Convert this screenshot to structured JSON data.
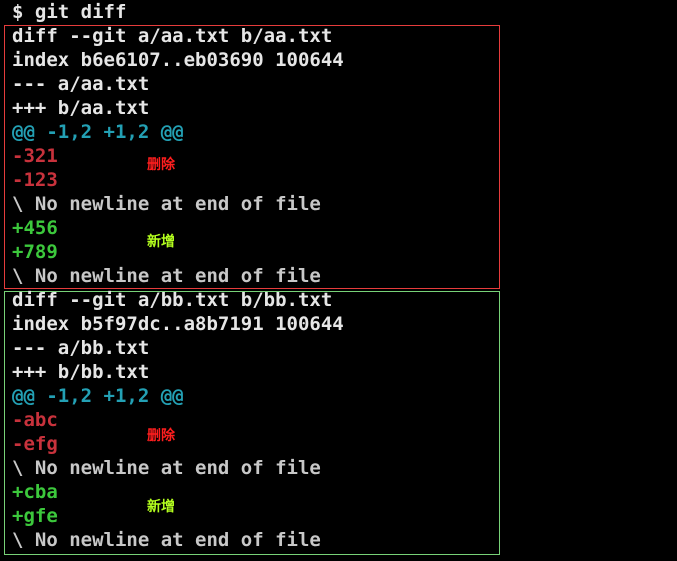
{
  "prompt": "$ git diff",
  "diffs": [
    {
      "header": "diff --git a/aa.txt b/aa.txt",
      "index": "index b6e6107..eb03690 100644",
      "from_file": "--- a/aa.txt",
      "to_file": "+++ b/aa.txt",
      "hunk": "@@ -1,2 +1,2 @@",
      "removed": [
        "-321",
        "-123"
      ],
      "no_newline_1": "\\ No newline at end of file",
      "added": [
        "+456",
        "+789"
      ],
      "no_newline_2": "\\ No newline at end of file",
      "removed_note": "删除",
      "added_note": "新增"
    },
    {
      "header": "diff --git a/bb.txt b/bb.txt",
      "index": "index b5f97dc..a8b7191 100644",
      "from_file": "--- a/bb.txt",
      "to_file": "+++ b/bb.txt",
      "hunk": "@@ -1,2 +1,2 @@",
      "removed": [
        "-abc",
        "-efg"
      ],
      "no_newline_1": "\\ No newline at end of file",
      "added": [
        "+cba",
        "+gfe"
      ],
      "no_newline_2": "\\ No newline at end of file",
      "removed_note": "删除",
      "added_note": "新增"
    }
  ],
  "colors": {
    "text": "#e6e6e6",
    "hunk": "#23a0b4",
    "removed": "#c8323c",
    "added": "#3cc83c",
    "box_first": "#e63c3c",
    "box_second": "#78d278",
    "note_removed": "#ff1e1e",
    "note_added": "#b4ff1e"
  }
}
